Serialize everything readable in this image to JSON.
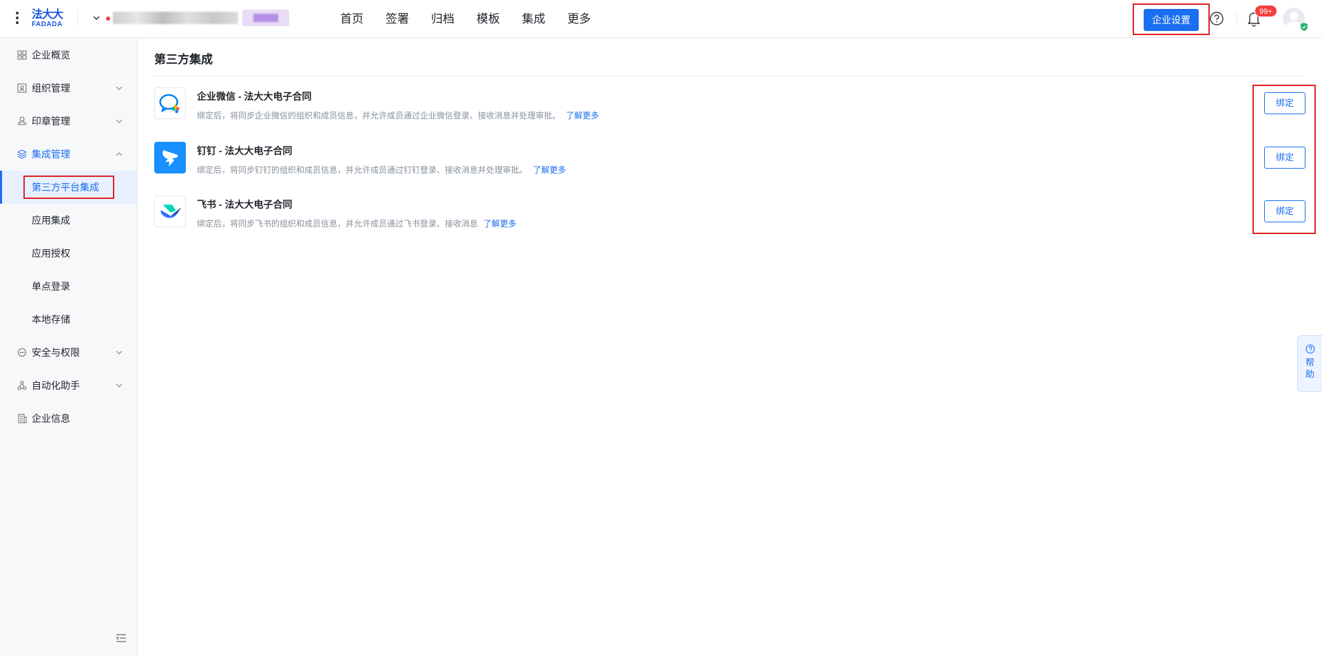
{
  "header": {
    "logo_cn": "法大大",
    "logo_en": "FADADA",
    "nav": [
      "首页",
      "签署",
      "归档",
      "模板",
      "集成",
      "更多"
    ],
    "enterprise_settings": "企业设置",
    "notification_badge": "99+"
  },
  "sidebar": {
    "items": [
      {
        "label": "企业概览",
        "icon": "overview-icon"
      },
      {
        "label": "组织管理",
        "icon": "org-icon"
      },
      {
        "label": "印章管理",
        "icon": "seal-icon"
      },
      {
        "label": "集成管理",
        "icon": "integration-icon"
      },
      {
        "label": "安全与权限",
        "icon": "security-icon"
      },
      {
        "label": "自动化助手",
        "icon": "automation-icon"
      },
      {
        "label": "企业信息",
        "icon": "company-info-icon"
      }
    ],
    "sub_items": [
      "第三方平台集成",
      "应用集成",
      "应用授权",
      "单点登录",
      "本地存储"
    ]
  },
  "main": {
    "title": "第三方集成",
    "integrations": [
      {
        "name": "企业微信 - 法大大电子合同",
        "desc": "绑定后，将同步企业微信的组织和成员信息，并允许成员通过企业微信登录、接收消息并处理审批。",
        "more": "了解更多",
        "action": "绑定",
        "icon": "wecom-icon"
      },
      {
        "name": "钉钉 - 法大大电子合同",
        "desc": "绑定后，将同步钉钉的组织和成员信息，并允许成员通过钉钉登录、接收消息并处理审批。",
        "more": "了解更多",
        "action": "绑定",
        "icon": "dingtalk-icon"
      },
      {
        "name": "飞书 - 法大大电子合同",
        "desc": "绑定后，将同步飞书的组织和成员信息，并允许成员通过飞书登录、接收消息",
        "more": "了解更多",
        "action": "绑定",
        "icon": "feishu-icon"
      }
    ]
  },
  "help_float": {
    "line1": "帮",
    "line2": "助"
  },
  "colors": {
    "primary": "#1a6ef0",
    "highlight": "#e02020",
    "badge": "#f53f3f"
  }
}
